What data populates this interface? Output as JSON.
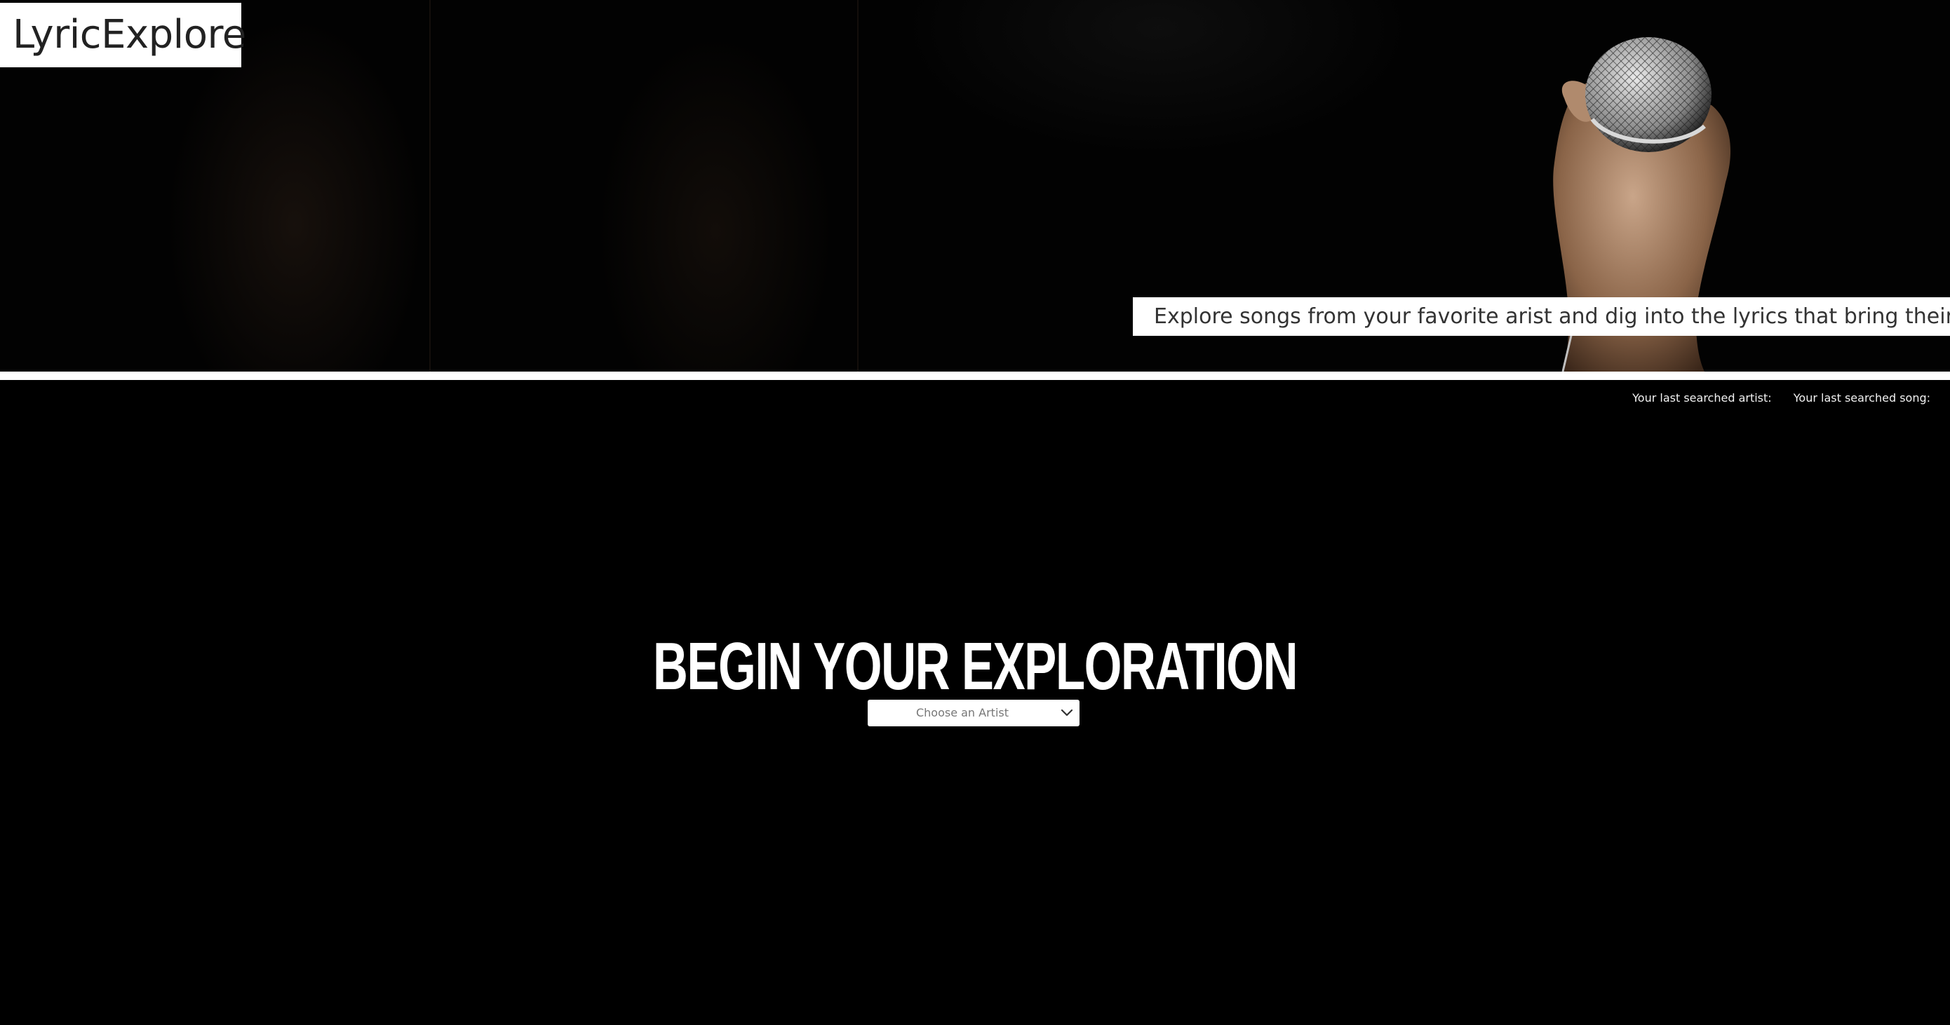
{
  "header": {
    "brand": "LyricExplore",
    "tagline": "Explore songs from your favorite arist and dig into the lyrics that bring their music alive",
    "hero_image_icon": "hand-holding-microphone-icon"
  },
  "history": {
    "last_artist_label": "Your last searched artist:",
    "last_song_label": "Your last searched song:"
  },
  "main": {
    "headline": "BEGIN YOUR EXPLORATION",
    "artist_select": {
      "placeholder": "Choose an Artist",
      "icon": "chevron-down-icon"
    }
  },
  "colors": {
    "background": "#000000",
    "panel": "#ffffff",
    "text_dark": "#222222",
    "text_light": "#ffffff"
  }
}
